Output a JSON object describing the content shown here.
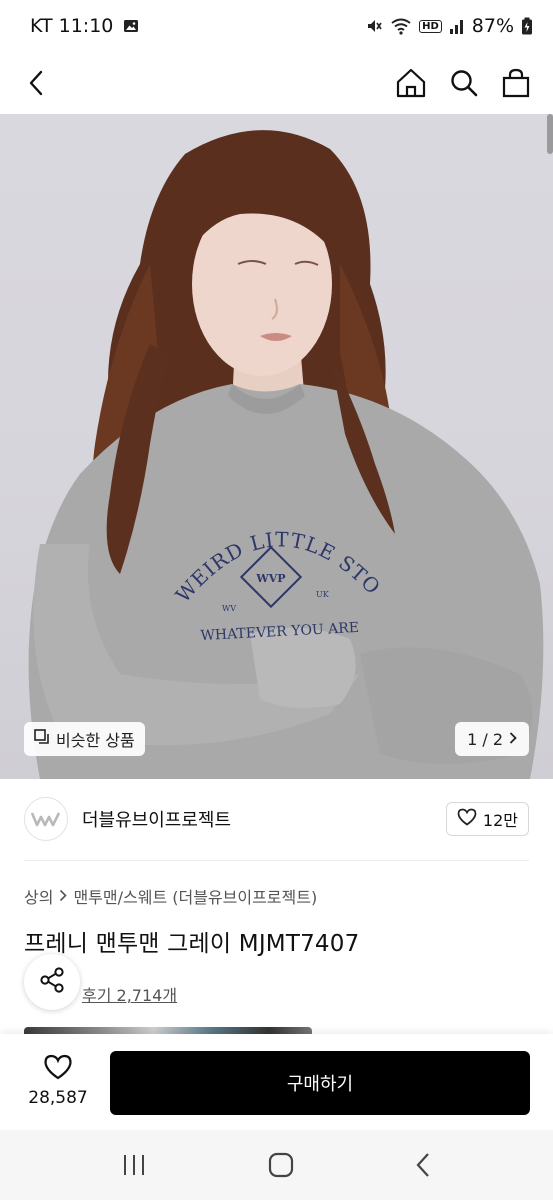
{
  "status_bar": {
    "carrier_time": "KT 11:10",
    "battery": "87%",
    "network_badge": "HD"
  },
  "hero": {
    "similar_label": "비슷한 상품",
    "pager": "1 / 2",
    "graphic_text": {
      "arc": "WEIRD LITTLE STORES",
      "bottom": "WHATEVER YOU ARE",
      "badge": "WVP",
      "left_small": "WV",
      "right_small": "UK"
    }
  },
  "brand": {
    "name": "더블유브이프로젝트",
    "likes": "12만"
  },
  "breadcrumb": {
    "category": "상의",
    "sub": "맨투맨/스웨트 (더블유브이프로젝트)"
  },
  "product": {
    "title": "프레니 맨투맨 그레이 MJMT7407",
    "reviews": "후기 2,714개"
  },
  "bottom_bar": {
    "wish_count": "28,587",
    "buy_label": "구매하기"
  },
  "colors": {
    "buy_button": "#000000",
    "hero_bg": "#d8d7dd",
    "sweatshirt": "#a7a7a7",
    "print": "#2d3769"
  }
}
